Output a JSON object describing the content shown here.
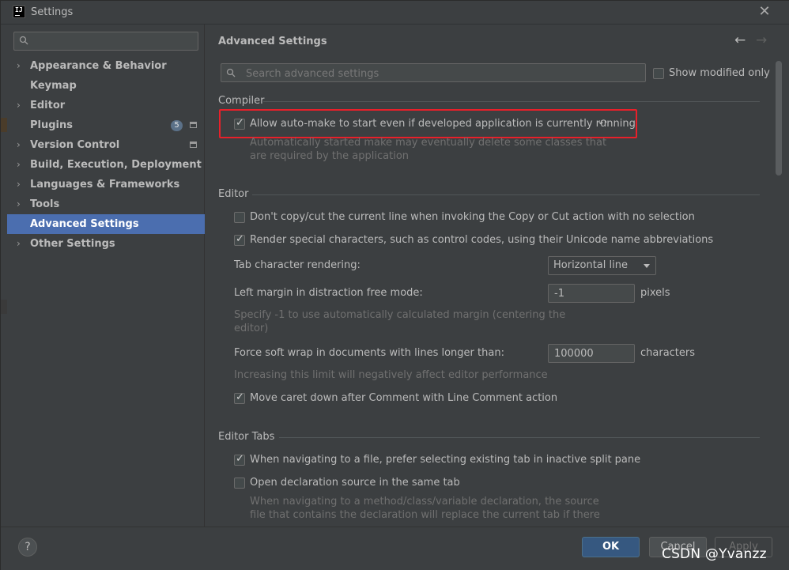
{
  "window": {
    "title": "Settings",
    "logo_text": "IJ"
  },
  "sidebar": {
    "search": {
      "value": "",
      "placeholder": ""
    },
    "items": [
      {
        "label": "Appearance & Behavior",
        "expandable": true
      },
      {
        "label": "Keymap",
        "expandable": false
      },
      {
        "label": "Editor",
        "expandable": true
      },
      {
        "label": "Plugins",
        "expandable": false,
        "badge": "5"
      },
      {
        "label": "Version Control",
        "expandable": true
      },
      {
        "label": "Build, Execution, Deployment",
        "expandable": true
      },
      {
        "label": "Languages & Frameworks",
        "expandable": true
      },
      {
        "label": "Tools",
        "expandable": true
      },
      {
        "label": "Advanced Settings",
        "expandable": false,
        "selected": true
      },
      {
        "label": "Other Settings",
        "expandable": true
      }
    ]
  },
  "content": {
    "title": "Advanced Settings",
    "search": {
      "placeholder": "Search advanced settings",
      "value": ""
    },
    "show_modified": {
      "label": "Show modified only",
      "checked": false
    },
    "compiler": {
      "title": "Compiler",
      "auto_make": {
        "label": "Allow auto-make to start even if developed application is currently running",
        "checked": true,
        "hint_line1": "Automatically started make may eventually delete some classes that",
        "hint_line2": "are required by the application"
      }
    },
    "editor": {
      "title": "Editor",
      "copy_cut": {
        "label": "Don't copy/cut the current line when invoking the Copy or Cut action with no selection",
        "checked": false
      },
      "render_special": {
        "label": "Render special characters, such as control codes, using their Unicode name abbreviations",
        "checked": true
      },
      "tab_rendering": {
        "label": "Tab character rendering:",
        "value": "Horizontal line"
      },
      "left_margin": {
        "label": "Left margin in distraction free mode:",
        "value": "-1",
        "unit": "pixels",
        "hint_line1": "Specify -1 to use automatically calculated margin (centering the",
        "hint_line2": "editor)"
      },
      "soft_wrap": {
        "label": "Force soft wrap in documents with lines longer than:",
        "value": "100000",
        "unit": "characters",
        "hint": "Increasing this limit will negatively affect editor performance"
      },
      "move_caret": {
        "label": "Move caret down after Comment with Line Comment action",
        "checked": true
      }
    },
    "editor_tabs": {
      "title": "Editor Tabs",
      "prefer_existing": {
        "label": "When navigating to a file, prefer selecting existing tab in inactive split pane",
        "checked": true
      },
      "open_same_tab": {
        "label": "Open declaration source in the same tab",
        "checked": false,
        "hint_line1": "When navigating to a method/class/variable declaration, the source",
        "hint_line2": "file that contains the declaration will replace the current tab if there"
      }
    }
  },
  "footer": {
    "help": "?",
    "ok": "OK",
    "cancel": "Cancel",
    "apply": "Apply"
  },
  "watermark": "CSDN @Yvanzz",
  "colors": {
    "background": "#3c3f41",
    "selection": "#4b6eaf",
    "primary_button": "#365880",
    "highlight_box": "#e8202a"
  }
}
